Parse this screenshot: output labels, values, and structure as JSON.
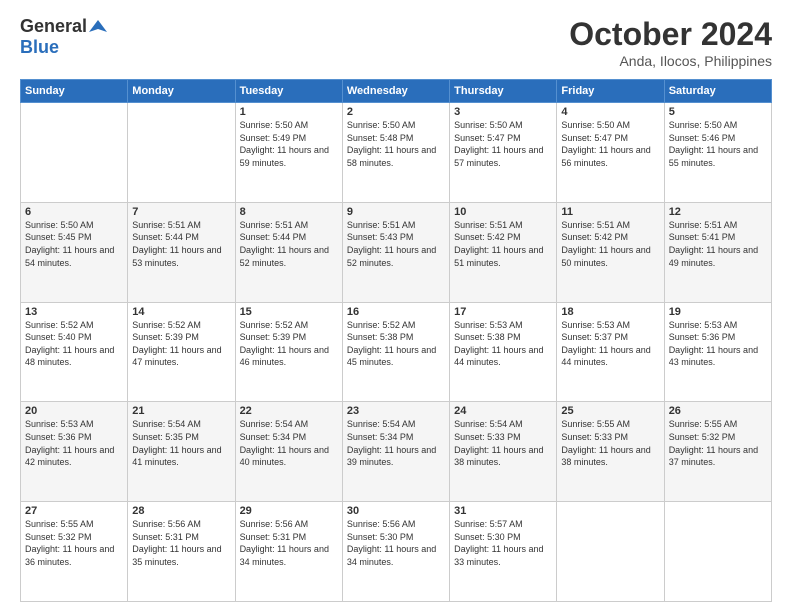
{
  "header": {
    "logo_general": "General",
    "logo_blue": "Blue",
    "title": "October 2024",
    "subtitle": "Anda, Ilocos, Philippines"
  },
  "calendar": {
    "days_of_week": [
      "Sunday",
      "Monday",
      "Tuesday",
      "Wednesday",
      "Thursday",
      "Friday",
      "Saturday"
    ],
    "weeks": [
      [
        {
          "day": "",
          "info": ""
        },
        {
          "day": "",
          "info": ""
        },
        {
          "day": "1",
          "info": "Sunrise: 5:50 AM\nSunset: 5:49 PM\nDaylight: 11 hours and 59 minutes."
        },
        {
          "day": "2",
          "info": "Sunrise: 5:50 AM\nSunset: 5:48 PM\nDaylight: 11 hours and 58 minutes."
        },
        {
          "day": "3",
          "info": "Sunrise: 5:50 AM\nSunset: 5:47 PM\nDaylight: 11 hours and 57 minutes."
        },
        {
          "day": "4",
          "info": "Sunrise: 5:50 AM\nSunset: 5:47 PM\nDaylight: 11 hours and 56 minutes."
        },
        {
          "day": "5",
          "info": "Sunrise: 5:50 AM\nSunset: 5:46 PM\nDaylight: 11 hours and 55 minutes."
        }
      ],
      [
        {
          "day": "6",
          "info": "Sunrise: 5:50 AM\nSunset: 5:45 PM\nDaylight: 11 hours and 54 minutes."
        },
        {
          "day": "7",
          "info": "Sunrise: 5:51 AM\nSunset: 5:44 PM\nDaylight: 11 hours and 53 minutes."
        },
        {
          "day": "8",
          "info": "Sunrise: 5:51 AM\nSunset: 5:44 PM\nDaylight: 11 hours and 52 minutes."
        },
        {
          "day": "9",
          "info": "Sunrise: 5:51 AM\nSunset: 5:43 PM\nDaylight: 11 hours and 52 minutes."
        },
        {
          "day": "10",
          "info": "Sunrise: 5:51 AM\nSunset: 5:42 PM\nDaylight: 11 hours and 51 minutes."
        },
        {
          "day": "11",
          "info": "Sunrise: 5:51 AM\nSunset: 5:42 PM\nDaylight: 11 hours and 50 minutes."
        },
        {
          "day": "12",
          "info": "Sunrise: 5:51 AM\nSunset: 5:41 PM\nDaylight: 11 hours and 49 minutes."
        }
      ],
      [
        {
          "day": "13",
          "info": "Sunrise: 5:52 AM\nSunset: 5:40 PM\nDaylight: 11 hours and 48 minutes."
        },
        {
          "day": "14",
          "info": "Sunrise: 5:52 AM\nSunset: 5:39 PM\nDaylight: 11 hours and 47 minutes."
        },
        {
          "day": "15",
          "info": "Sunrise: 5:52 AM\nSunset: 5:39 PM\nDaylight: 11 hours and 46 minutes."
        },
        {
          "day": "16",
          "info": "Sunrise: 5:52 AM\nSunset: 5:38 PM\nDaylight: 11 hours and 45 minutes."
        },
        {
          "day": "17",
          "info": "Sunrise: 5:53 AM\nSunset: 5:38 PM\nDaylight: 11 hours and 44 minutes."
        },
        {
          "day": "18",
          "info": "Sunrise: 5:53 AM\nSunset: 5:37 PM\nDaylight: 11 hours and 44 minutes."
        },
        {
          "day": "19",
          "info": "Sunrise: 5:53 AM\nSunset: 5:36 PM\nDaylight: 11 hours and 43 minutes."
        }
      ],
      [
        {
          "day": "20",
          "info": "Sunrise: 5:53 AM\nSunset: 5:36 PM\nDaylight: 11 hours and 42 minutes."
        },
        {
          "day": "21",
          "info": "Sunrise: 5:54 AM\nSunset: 5:35 PM\nDaylight: 11 hours and 41 minutes."
        },
        {
          "day": "22",
          "info": "Sunrise: 5:54 AM\nSunset: 5:34 PM\nDaylight: 11 hours and 40 minutes."
        },
        {
          "day": "23",
          "info": "Sunrise: 5:54 AM\nSunset: 5:34 PM\nDaylight: 11 hours and 39 minutes."
        },
        {
          "day": "24",
          "info": "Sunrise: 5:54 AM\nSunset: 5:33 PM\nDaylight: 11 hours and 38 minutes."
        },
        {
          "day": "25",
          "info": "Sunrise: 5:55 AM\nSunset: 5:33 PM\nDaylight: 11 hours and 38 minutes."
        },
        {
          "day": "26",
          "info": "Sunrise: 5:55 AM\nSunset: 5:32 PM\nDaylight: 11 hours and 37 minutes."
        }
      ],
      [
        {
          "day": "27",
          "info": "Sunrise: 5:55 AM\nSunset: 5:32 PM\nDaylight: 11 hours and 36 minutes."
        },
        {
          "day": "28",
          "info": "Sunrise: 5:56 AM\nSunset: 5:31 PM\nDaylight: 11 hours and 35 minutes."
        },
        {
          "day": "29",
          "info": "Sunrise: 5:56 AM\nSunset: 5:31 PM\nDaylight: 11 hours and 34 minutes."
        },
        {
          "day": "30",
          "info": "Sunrise: 5:56 AM\nSunset: 5:30 PM\nDaylight: 11 hours and 34 minutes."
        },
        {
          "day": "31",
          "info": "Sunrise: 5:57 AM\nSunset: 5:30 PM\nDaylight: 11 hours and 33 minutes."
        },
        {
          "day": "",
          "info": ""
        },
        {
          "day": "",
          "info": ""
        }
      ]
    ]
  }
}
